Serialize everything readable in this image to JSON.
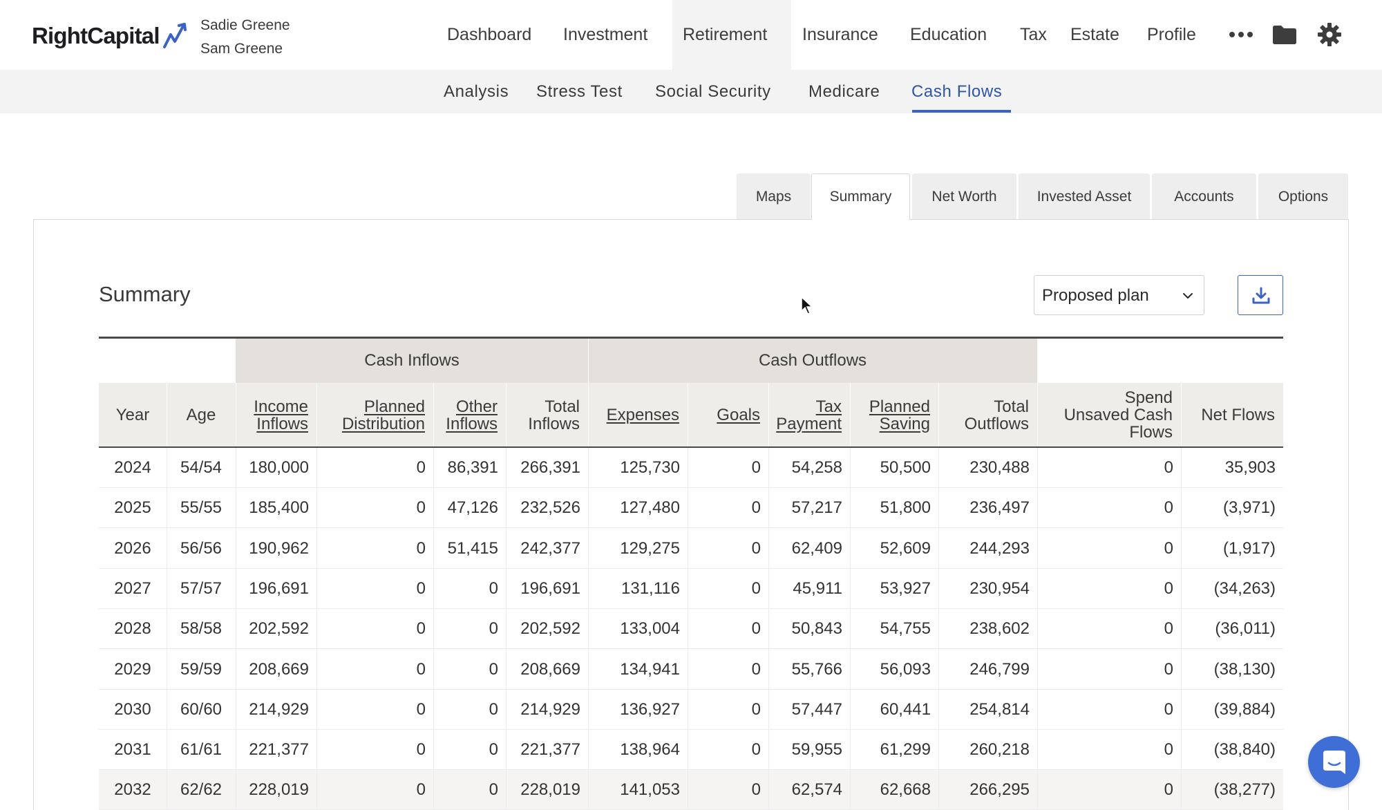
{
  "brand": {
    "logo_text": "RightCapital"
  },
  "clients": {
    "primary": "Sadie Greene",
    "secondary": "Sam Greene"
  },
  "main_nav": {
    "items": [
      {
        "label": "Dashboard",
        "active": false
      },
      {
        "label": "Investment",
        "active": false
      },
      {
        "label": "Retirement",
        "active": true
      },
      {
        "label": "Insurance",
        "active": false
      },
      {
        "label": "Education",
        "active": false
      },
      {
        "label": "Tax",
        "active": false
      },
      {
        "label": "Estate",
        "active": false
      },
      {
        "label": "Profile",
        "active": false
      }
    ],
    "more_icon": "more-horizontal-icon",
    "folder_icon": "folder-icon",
    "settings_icon": "gear-icon"
  },
  "sub_nav": {
    "items": [
      {
        "label": "Analysis",
        "active": false
      },
      {
        "label": "Stress Test",
        "active": false
      },
      {
        "label": "Social Security",
        "active": false
      },
      {
        "label": "Medicare",
        "active": false
      },
      {
        "label": "Cash Flows",
        "active": true
      }
    ]
  },
  "tabs": [
    {
      "label": "Maps",
      "active": false
    },
    {
      "label": "Summary",
      "active": true
    },
    {
      "label": "Net Worth",
      "active": false
    },
    {
      "label": "Invested Asset",
      "active": false
    },
    {
      "label": "Accounts",
      "active": false
    },
    {
      "label": "Options",
      "active": false
    }
  ],
  "summary": {
    "title": "Summary",
    "plan_select": {
      "value": "Proposed plan"
    },
    "download_icon": "download-icon"
  },
  "table": {
    "groups": {
      "inflows": "Cash Inflows",
      "outflows": "Cash Outflows"
    },
    "columns": {
      "year": "Year",
      "age": "Age",
      "income_inflows": [
        "Income",
        "Inflows"
      ],
      "planned_distribution": [
        "Planned",
        "Distribution"
      ],
      "other_inflows": [
        "Other",
        "Inflows"
      ],
      "total_inflows": [
        "Total",
        "Inflows"
      ],
      "expenses": "Expenses",
      "goals": "Goals",
      "tax_payment": [
        "Tax",
        "Payment"
      ],
      "planned_saving": [
        "Planned",
        "Saving"
      ],
      "total_outflows": [
        "Total",
        "Outflows"
      ],
      "spend_unsaved": [
        "Spend",
        "Unsaved Cash",
        "Flows"
      ],
      "net_flows": "Net Flows"
    },
    "rows": [
      [
        "2024",
        "54/54",
        "180,000",
        "0",
        "86,391",
        "266,391",
        "125,730",
        "0",
        "54,258",
        "50,500",
        "230,488",
        "0",
        "35,903"
      ],
      [
        "2025",
        "55/55",
        "185,400",
        "0",
        "47,126",
        "232,526",
        "127,480",
        "0",
        "57,217",
        "51,800",
        "236,497",
        "0",
        "(3,971)"
      ],
      [
        "2026",
        "56/56",
        "190,962",
        "0",
        "51,415",
        "242,377",
        "129,275",
        "0",
        "62,409",
        "52,609",
        "244,293",
        "0",
        "(1,917)"
      ],
      [
        "2027",
        "57/57",
        "196,691",
        "0",
        "0",
        "196,691",
        "131,116",
        "0",
        "45,911",
        "53,927",
        "230,954",
        "0",
        "(34,263)"
      ],
      [
        "2028",
        "58/58",
        "202,592",
        "0",
        "0",
        "202,592",
        "133,004",
        "0",
        "50,843",
        "54,755",
        "238,602",
        "0",
        "(36,011)"
      ],
      [
        "2029",
        "59/59",
        "208,669",
        "0",
        "0",
        "208,669",
        "134,941",
        "0",
        "55,766",
        "56,093",
        "246,799",
        "0",
        "(38,130)"
      ],
      [
        "2030",
        "60/60",
        "214,929",
        "0",
        "0",
        "214,929",
        "136,927",
        "0",
        "57,447",
        "60,441",
        "254,814",
        "0",
        "(39,884)"
      ],
      [
        "2031",
        "61/61",
        "221,377",
        "0",
        "0",
        "221,377",
        "138,964",
        "0",
        "59,955",
        "61,299",
        "260,218",
        "0",
        "(38,840)"
      ],
      [
        "2032",
        "62/62",
        "228,019",
        "0",
        "0",
        "228,019",
        "141,053",
        "0",
        "62,574",
        "62,668",
        "266,295",
        "0",
        "(38,277)"
      ]
    ]
  },
  "chat": {
    "icon": "chat-icon"
  },
  "colors": {
    "accent": "#3c63c4",
    "group_header": "#e4e1dc",
    "column_header": "#efede9",
    "subnav_bg": "#f3f3f3"
  }
}
